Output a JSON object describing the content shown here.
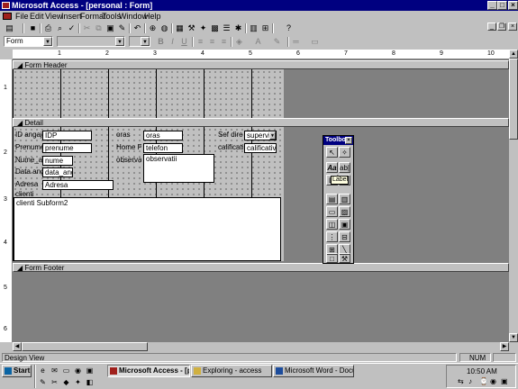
{
  "window": {
    "title": "Microsoft Access - [personal : Form]",
    "min_glyph": "_",
    "max_glyph": "□",
    "close_glyph": "×"
  },
  "menubar": {
    "items": [
      "File",
      "Edit",
      "View",
      "Insert",
      "Format",
      "Tools",
      "Window",
      "Help"
    ]
  },
  "formatting_toolbar": {
    "object_combo": "Form"
  },
  "ruler": {
    "h_numbers": [
      "1",
      "2",
      "3",
      "4",
      "5",
      "6",
      "7",
      "8",
      "9",
      "10"
    ],
    "v_numbers": [
      "1",
      "2",
      "3",
      "4",
      "5",
      "6"
    ]
  },
  "sections": {
    "header": "Form Header",
    "detail": "Detail",
    "footer": "Form Footer"
  },
  "detail_controls": {
    "labels": [
      "ID angajat",
      "Prenume_",
      "Nume_ang",
      "Data angaj",
      "Adresa",
      "clienti",
      "oras",
      "Home Pho",
      "observatii",
      "Sef direct",
      "calificativ"
    ],
    "fields": [
      "IDP",
      "prenume",
      "nume",
      "data_angaj",
      "Adresa",
      "oras",
      "telefon",
      "observatii",
      "supervizo",
      "calificativ"
    ],
    "subform": "clienti Subform2"
  },
  "toolbox": {
    "title": "Toolbox",
    "tooltip": "Label"
  },
  "statusbar": {
    "left": "Design View",
    "num": "NUM"
  },
  "taskbar": {
    "start": "Start",
    "tasks": [
      "Microsoft Access - [p...",
      "Exploring - access",
      "Microsoft Word - Document2"
    ],
    "clock": "10:50 AM"
  }
}
